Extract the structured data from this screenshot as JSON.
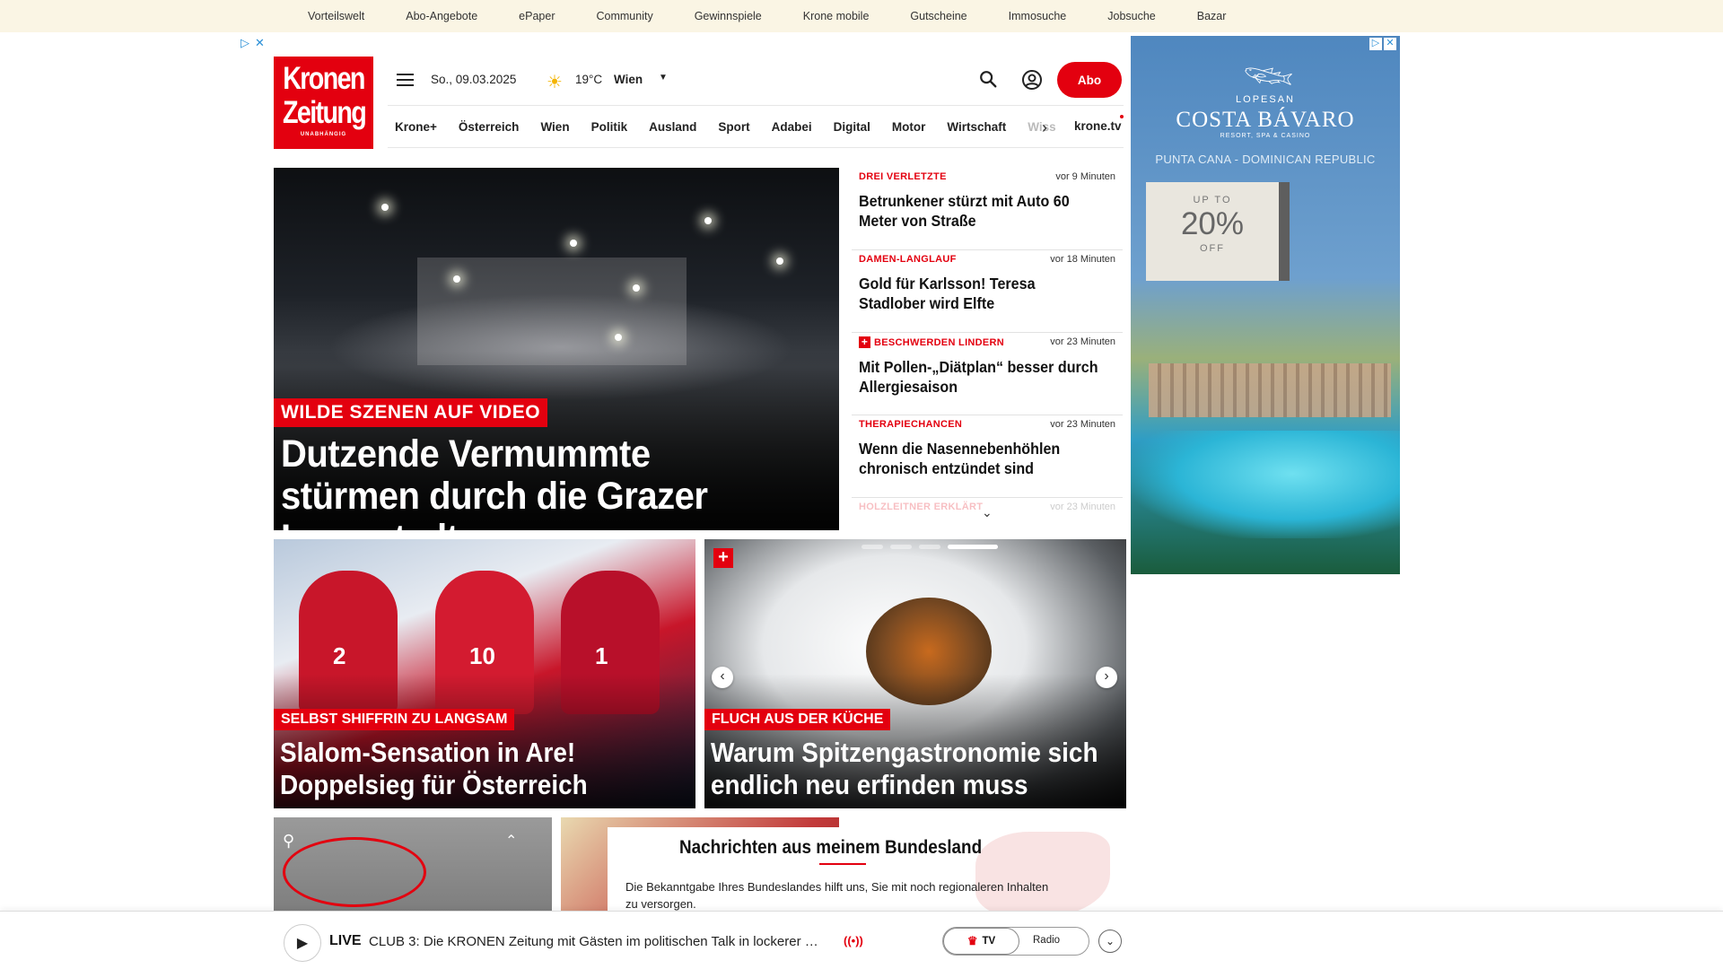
{
  "topbar": {
    "links": [
      "Vorteilswelt",
      "Abo-Angebote",
      "ePaper",
      "Community",
      "Gewinnspiele",
      "Krone mobile",
      "Gutscheine",
      "Immosuche",
      "Jobsuche",
      "Bazar"
    ]
  },
  "logo": {
    "line1": "Kronen",
    "line2": "Zeitung",
    "tagline": "UNABHÄNGIG"
  },
  "header": {
    "date": "So., 09.03.2025",
    "temperature": "19°C",
    "city": "Wien",
    "abo_label": "Abo"
  },
  "nav": {
    "items": [
      "Krone+",
      "Österreich",
      "Wien",
      "Politik",
      "Ausland",
      "Sport",
      "Adabei",
      "Digital",
      "Motor",
      "Wirtschaft"
    ],
    "faded_item": "Wiss",
    "tv_label": "krone.tv"
  },
  "hero": {
    "kicker": "WILDE SZENEN AUF VIDEO",
    "title": "Dutzende Vermummte stürmen durch die Grazer Innenstadt"
  },
  "ticker": [
    {
      "category": "DREI VERLETZTE",
      "time": "vor 9 Minuten",
      "headline": "Betrunkener stürzt mit Auto 60 Meter von Straße",
      "plus": false
    },
    {
      "category": "DAMEN-LANGLAUF",
      "time": "vor 18 Minuten",
      "headline": "Gold für Karlsson! Teresa Stadlober wird Elfte",
      "plus": false
    },
    {
      "category": "BESCHWERDEN LINDERN",
      "time": "vor 23 Minuten",
      "headline": "Mit Pollen-„Diätplan“ besser durch Allergiesaison",
      "plus": true
    },
    {
      "category": "THERAPIECHANCEN",
      "time": "vor 23 Minuten",
      "headline": "Wenn die Nasennebenhöhlen chronisch entzündet sind",
      "plus": false
    },
    {
      "category": "HOLZLEITNER ERKLÄRT",
      "time": "vor 23 Minuten"
    }
  ],
  "cards": [
    {
      "kicker": "SELBST SHIFFRIN ZU LANGSAM",
      "title": "Slalom-Sensation in Are! Doppelsieg für Österreich",
      "bibs": [
        "2",
        "10",
        "1"
      ]
    },
    {
      "kicker": "FLUCH AUS DER KÜCHE",
      "title": "Warum Spitzengastronomie sich endlich neu erfinden muss"
    }
  ],
  "ad": {
    "brand": "LOPESAN",
    "name": "COSTA BÁVARO",
    "sub": "RESORT, SPA & CASINO",
    "location": "PUNTA CANA - DOMINICAN REPUBLIC",
    "promo_up": "UP TO",
    "promo_pct": "20%",
    "promo_off": "OFF"
  },
  "bundesland": {
    "title": "Nachrichten aus meinem Bundesland",
    "text": "Die Bekanntgabe Ihres Bundeslandes hilft uns, Sie mit noch regionaleren Inhalten zu versorgen."
  },
  "live": {
    "label": "LIVE",
    "text": "CLUB 3: Die KRONEN Zeitung mit Gästen im politischen Talk in lockerer …",
    "tv_label": "TV",
    "radio_label": "Radio"
  },
  "colors": {
    "brand_red": "#e3000f",
    "topbar_bg": "#faf5e4"
  }
}
